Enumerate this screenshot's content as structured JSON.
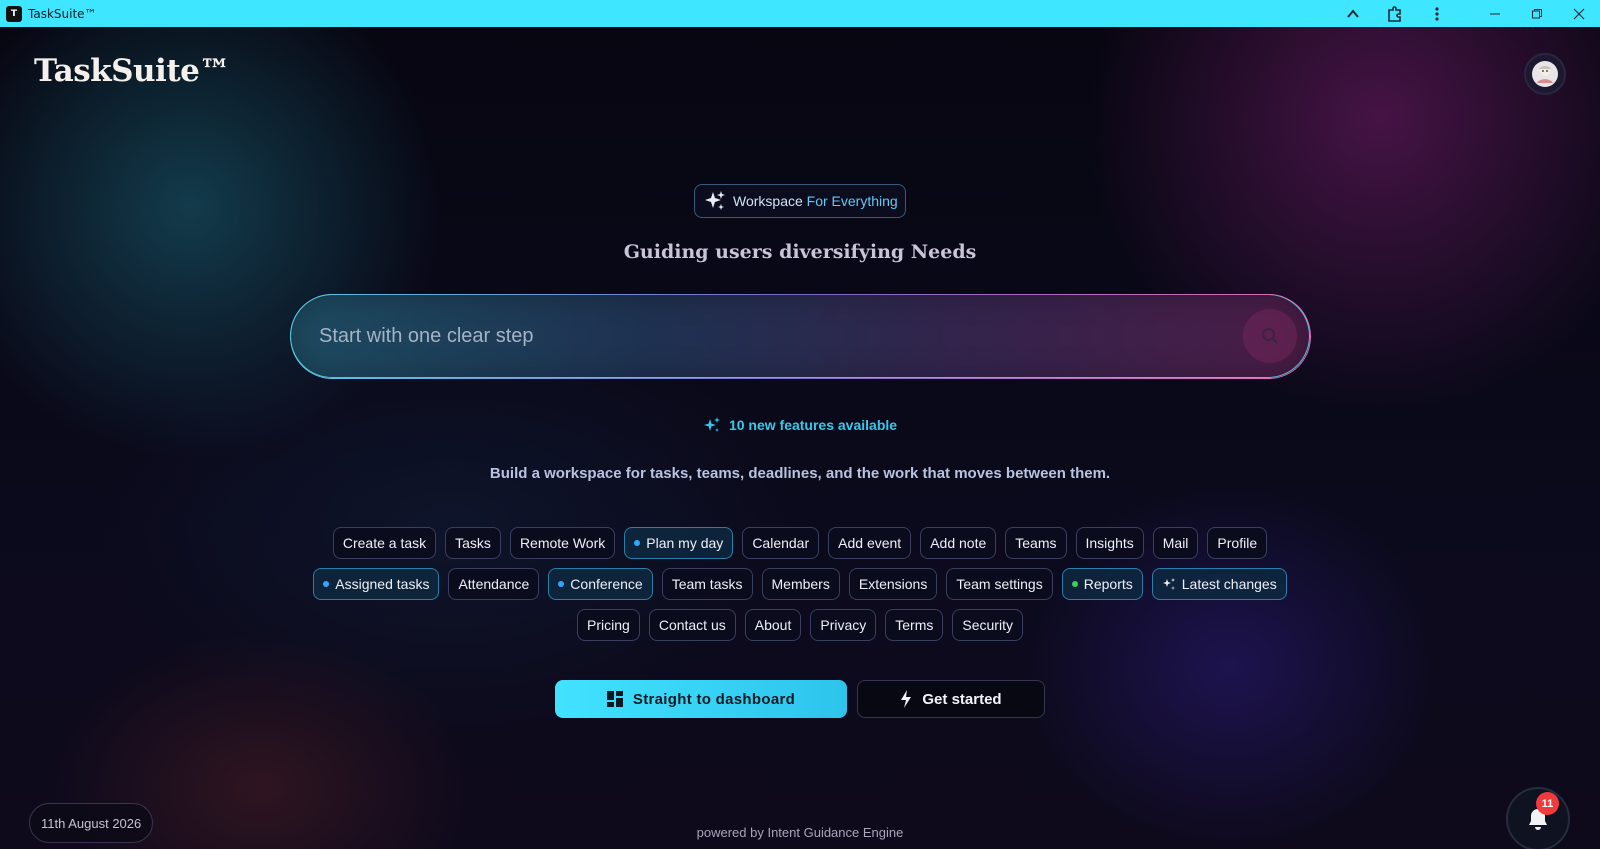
{
  "window": {
    "app_icon_letter": "T",
    "title": "TaskSuite™"
  },
  "header": {
    "logo": "TaskSuite™",
    "avatar_icon": "user-avatar"
  },
  "hero": {
    "badge_prefix": "Workspace ",
    "badge_accent": "For Everything",
    "tagline": "Guiding users diversifying Needs",
    "search_placeholder": "Start with one clear step",
    "features_text": "10 new features available",
    "subtitle": "Build a workspace for tasks, teams, deadlines, and the work that moves between them."
  },
  "chips": {
    "row1": [
      {
        "label": "Create a task"
      },
      {
        "label": "Tasks"
      },
      {
        "label": "Remote Work"
      },
      {
        "label": "Plan my day",
        "highlight": true,
        "dot": "#2ea8ff"
      },
      {
        "label": "Calendar"
      },
      {
        "label": "Add event"
      },
      {
        "label": "Add note"
      },
      {
        "label": "Teams"
      },
      {
        "label": "Insights"
      },
      {
        "label": "Mail"
      },
      {
        "label": "Profile"
      }
    ],
    "row2": [
      {
        "label": "Assigned tasks",
        "highlight": true,
        "dot": "#2ea8ff"
      },
      {
        "label": "Attendance"
      },
      {
        "label": "Conference",
        "highlight": true,
        "dot": "#2ea8ff"
      },
      {
        "label": "Team tasks"
      },
      {
        "label": "Members"
      },
      {
        "label": "Extensions"
      },
      {
        "label": "Team settings"
      },
      {
        "label": "Reports",
        "highlight": true,
        "dot": "#3ccf5a"
      },
      {
        "label": "Latest changes",
        "highlight": true,
        "icon": "sparkle-icon"
      }
    ],
    "row3": [
      {
        "label": "Pricing"
      },
      {
        "label": "Contact us"
      },
      {
        "label": "About"
      },
      {
        "label": "Privacy"
      },
      {
        "label": "Terms"
      },
      {
        "label": "Security"
      }
    ]
  },
  "cta": {
    "primary_label": "Straight to dashboard",
    "secondary_label": "Get started"
  },
  "footer": {
    "date": "11th August 2026",
    "powered_by": "powered by Intent Guidance Engine",
    "notification_count": "11"
  },
  "colors": {
    "titlebar": "#3fe6ff",
    "accent_cyan": "#34c9ea",
    "primary_button": "#42e2ff",
    "badge_red": "#ef3b3b"
  }
}
